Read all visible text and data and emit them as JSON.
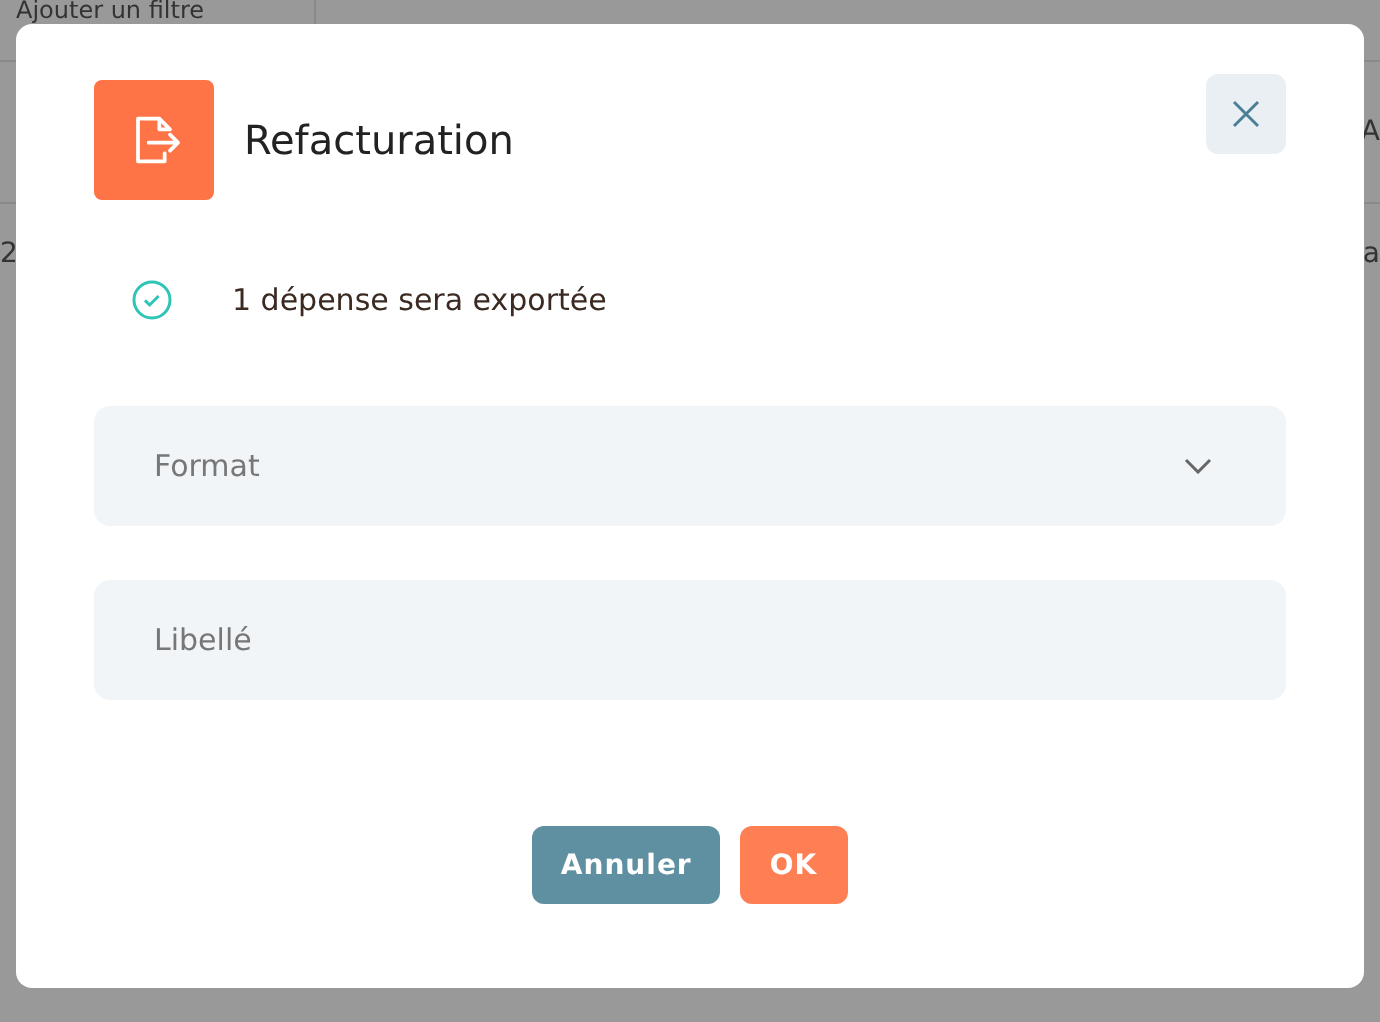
{
  "background": {
    "filter_button": "Ajouter un filtre",
    "column_3": "A",
    "row_cells": [
      "2",
      "a"
    ]
  },
  "dialog": {
    "title": "Refacturation",
    "message": "1 dépense sera exportée",
    "fields": [
      {
        "kind": "select",
        "placeholder": "Format"
      },
      {
        "kind": "text",
        "placeholder": "Libellé"
      }
    ],
    "buttons": [
      {
        "kind": "secondary",
        "label": "Annuler"
      },
      {
        "kind": "primary",
        "label": "OK"
      }
    ]
  }
}
